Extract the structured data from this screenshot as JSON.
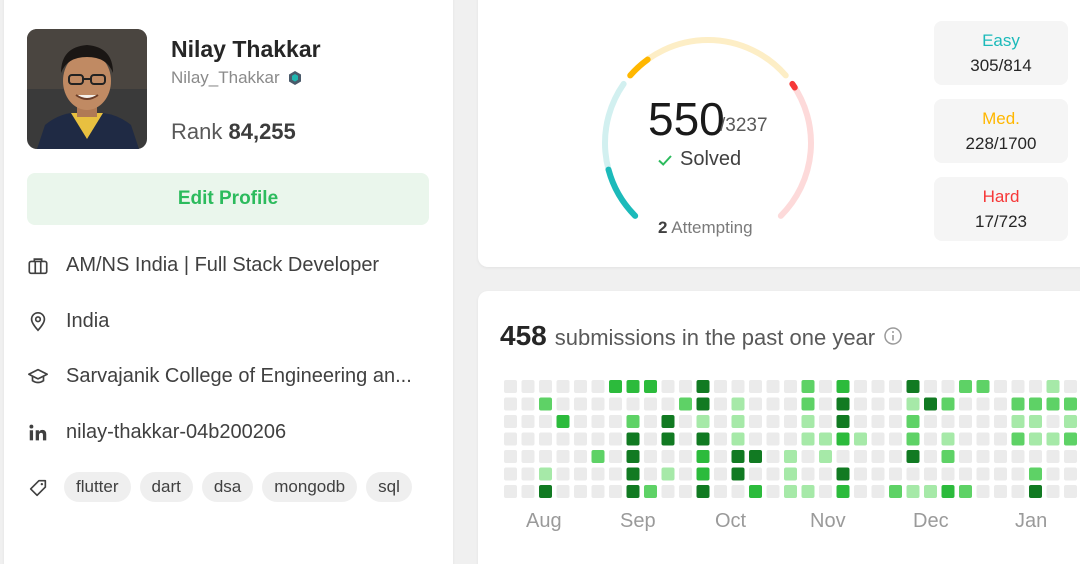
{
  "profile": {
    "name": "Nilay Thakkar",
    "username": "Nilay_Thakkar",
    "rank_label": "Rank",
    "rank_value": "84,255",
    "edit_button": "Edit Profile",
    "company": "AM/NS India | Full Stack Developer",
    "location": "India",
    "school": "Sarvajanik College of Engineering an...",
    "linkedin": "nilay-thakkar-04b200206",
    "tags": [
      "flutter",
      "dart",
      "dsa",
      "mongodb",
      "sql"
    ]
  },
  "solved": {
    "count": "550",
    "total": "/3237",
    "label": "Solved",
    "attempting_count": "2",
    "attempting_label": "Attempting",
    "easy_fraction": 0.375,
    "medium_fraction": 0.134,
    "hard_fraction": 0.024,
    "difficulty": [
      {
        "label": "Easy",
        "value": "305/814",
        "color": "#1cbaba"
      },
      {
        "label": "Med.",
        "value": "228/1700",
        "color": "#ffb700"
      },
      {
        "label": "Hard",
        "value": "17/723",
        "color": "#f63737"
      }
    ]
  },
  "calendar": {
    "count": "458",
    "text": "submissions in the past one year",
    "months": [
      "Aug",
      "Sep",
      "Oct",
      "Nov",
      "Dec",
      "Jan"
    ],
    "colors": [
      "#ebebeb",
      "#a6e9a8",
      "#5ed266",
      "#2cbb3c",
      "#117a22"
    ],
    "weeks": [
      [
        0,
        0,
        0,
        0,
        0,
        0,
        0
      ],
      [
        0,
        0,
        0,
        0,
        0,
        0,
        0
      ],
      [
        0,
        2,
        0,
        0,
        0,
        1,
        4
      ],
      [
        0,
        0,
        3,
        0,
        0,
        0,
        0
      ],
      [
        0,
        0,
        0,
        0,
        0,
        0,
        0
      ],
      [
        0,
        0,
        0,
        0,
        2,
        0,
        0
      ],
      [
        3,
        0,
        0,
        0,
        0,
        0,
        0
      ],
      [
        3,
        0,
        2,
        4,
        4,
        4,
        4
      ],
      [
        3,
        0,
        0,
        0,
        0,
        0,
        2
      ],
      [
        0,
        0,
        4,
        4,
        0,
        1,
        0
      ],
      [
        0,
        2,
        0,
        0,
        0,
        0,
        0
      ],
      [
        4,
        4,
        1,
        4,
        3,
        3,
        4
      ],
      [
        0,
        0,
        0,
        0,
        0,
        0,
        0
      ],
      [
        0,
        1,
        1,
        1,
        4,
        4,
        0
      ],
      [
        0,
        0,
        0,
        0,
        4,
        0,
        3
      ],
      [
        0,
        0,
        0,
        0,
        0,
        0,
        0
      ],
      [
        0,
        0,
        0,
        0,
        1,
        1,
        1
      ],
      [
        2,
        2,
        1,
        1,
        0,
        0,
        1
      ],
      [
        0,
        0,
        0,
        1,
        1,
        0,
        0
      ],
      [
        3,
        4,
        4,
        3,
        0,
        4,
        3
      ],
      [
        0,
        0,
        0,
        1,
        0,
        0,
        0
      ],
      [
        0,
        0,
        0,
        0,
        0,
        0,
        0
      ],
      [
        0,
        0,
        0,
        0,
        0,
        0,
        2
      ],
      [
        4,
        1,
        2,
        2,
        4,
        0,
        1
      ],
      [
        0,
        4,
        0,
        0,
        0,
        0,
        1
      ],
      [
        0,
        2,
        0,
        1,
        2,
        0,
        3
      ],
      [
        2,
        0,
        0,
        0,
        0,
        0,
        2
      ],
      [
        2,
        0,
        0,
        0,
        0,
        0,
        0
      ],
      [
        0,
        0,
        0,
        0,
        0,
        0,
        0
      ],
      [
        0,
        2,
        1,
        2,
        0,
        0,
        0
      ],
      [
        0,
        2,
        1,
        1,
        0,
        2,
        4
      ],
      [
        1,
        2,
        0,
        1,
        0,
        0,
        0
      ],
      [
        0,
        2,
        1,
        2,
        0,
        0,
        0
      ],
      [
        0,
        2,
        0,
        0,
        0,
        0,
        0
      ]
    ]
  }
}
